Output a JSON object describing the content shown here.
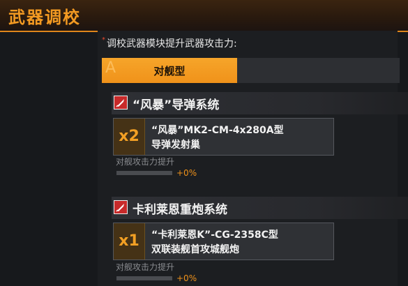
{
  "header": {
    "title": "武器调校"
  },
  "subtitle": {
    "star": "*",
    "text": "调校武器模块提升武器攻击力:"
  },
  "tab": {
    "letter": "A",
    "label": "对舰型"
  },
  "colors": {
    "accent": "#f0921a",
    "section_icon": "#c72a2a",
    "count_bg": "#453216"
  },
  "sections": [
    {
      "icon": "missile-icon",
      "title": "“风暴”导弹系统",
      "count": "x2",
      "name_line1": "“风暴”MK2-CM-4x280A型",
      "name_line2": "导弹发射巢",
      "stat_label": "对舰攻击力提升",
      "stat_value": "+0%",
      "progress": 0
    },
    {
      "icon": "cannon-icon",
      "title": "卡利莱恩重炮系统",
      "count": "x1",
      "name_line1": "“卡利莱恩K”-CG-2358C型",
      "name_line2": "双联装舰首攻城舰炮",
      "stat_label": "对舰攻击力提升",
      "stat_value": "+0%",
      "progress": 0
    }
  ]
}
